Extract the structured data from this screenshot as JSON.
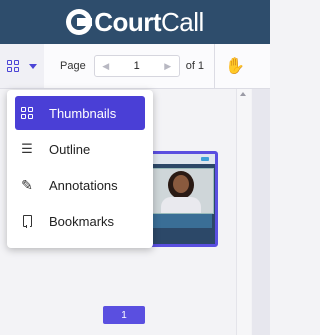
{
  "banner": {
    "brand_bold": "Court",
    "brand_light": "Call"
  },
  "toolbar": {
    "page_label": "Page",
    "page_value": "1",
    "of_label": "of 1",
    "prev_icon": "chevron-left-icon",
    "next_icon": "chevron-right-icon",
    "hand_icon": "hand-pan-icon"
  },
  "menu": {
    "items": [
      {
        "label": "Thumbnails",
        "icon": "grid-icon",
        "active": true
      },
      {
        "label": "Outline",
        "icon": "outline-list-icon",
        "active": false
      },
      {
        "label": "Annotations",
        "icon": "pen-icon",
        "active": false
      },
      {
        "label": "Bookmarks",
        "icon": "bookmark-icon",
        "active": false
      }
    ]
  },
  "thumbnail": {
    "page_number": "1"
  },
  "colors": {
    "accent": "#4a3fd6",
    "banner": "#2e4d6c"
  }
}
